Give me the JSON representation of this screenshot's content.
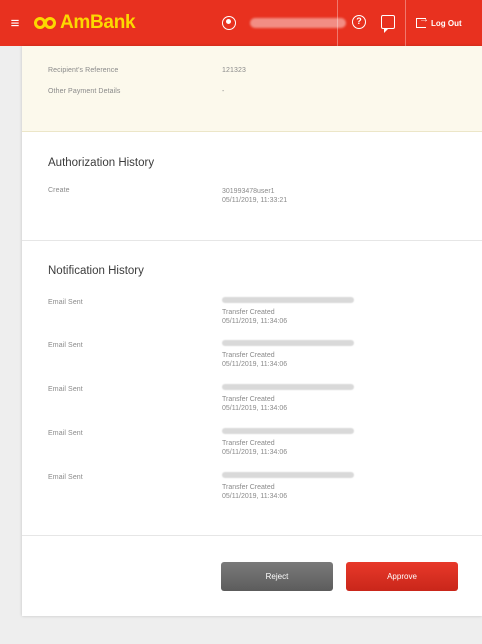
{
  "header": {
    "brand": "AmBank",
    "logout_label": "Log Out",
    "colors": {
      "bar": "#e8311f",
      "brand_text": "#fcd800"
    },
    "icons": [
      "hamburger-icon",
      "user-icon",
      "help-icon",
      "chat-icon",
      "logout-icon"
    ]
  },
  "reference": {
    "recipient_reference_label": "Recipient's Reference",
    "recipient_reference_value": "121323",
    "other_payment_label": "Other Payment Details",
    "other_payment_value": "-"
  },
  "authorization": {
    "title": "Authorization History",
    "entry_label": "Create",
    "entry_user": "301993478user1",
    "entry_time": "05/11/2019, 11:33:21"
  },
  "notification": {
    "title": "Notification History",
    "items": [
      {
        "label": "Email Sent",
        "status": "Transfer Created",
        "time": "05/11/2019, 11:34:06"
      },
      {
        "label": "Email Sent",
        "status": "Transfer Created",
        "time": "05/11/2019, 11:34:06"
      },
      {
        "label": "Email Sent",
        "status": "Transfer Created",
        "time": "05/11/2019, 11:34:06"
      },
      {
        "label": "Email Sent",
        "status": "Transfer Created",
        "time": "05/11/2019, 11:34:06"
      },
      {
        "label": "Email Sent",
        "status": "Transfer Created",
        "time": "05/11/2019, 11:34:06"
      }
    ]
  },
  "actions": {
    "reject_label": "Reject",
    "approve_label": "Approve",
    "colors": {
      "reject": "#666666",
      "approve": "#d9301f"
    }
  }
}
